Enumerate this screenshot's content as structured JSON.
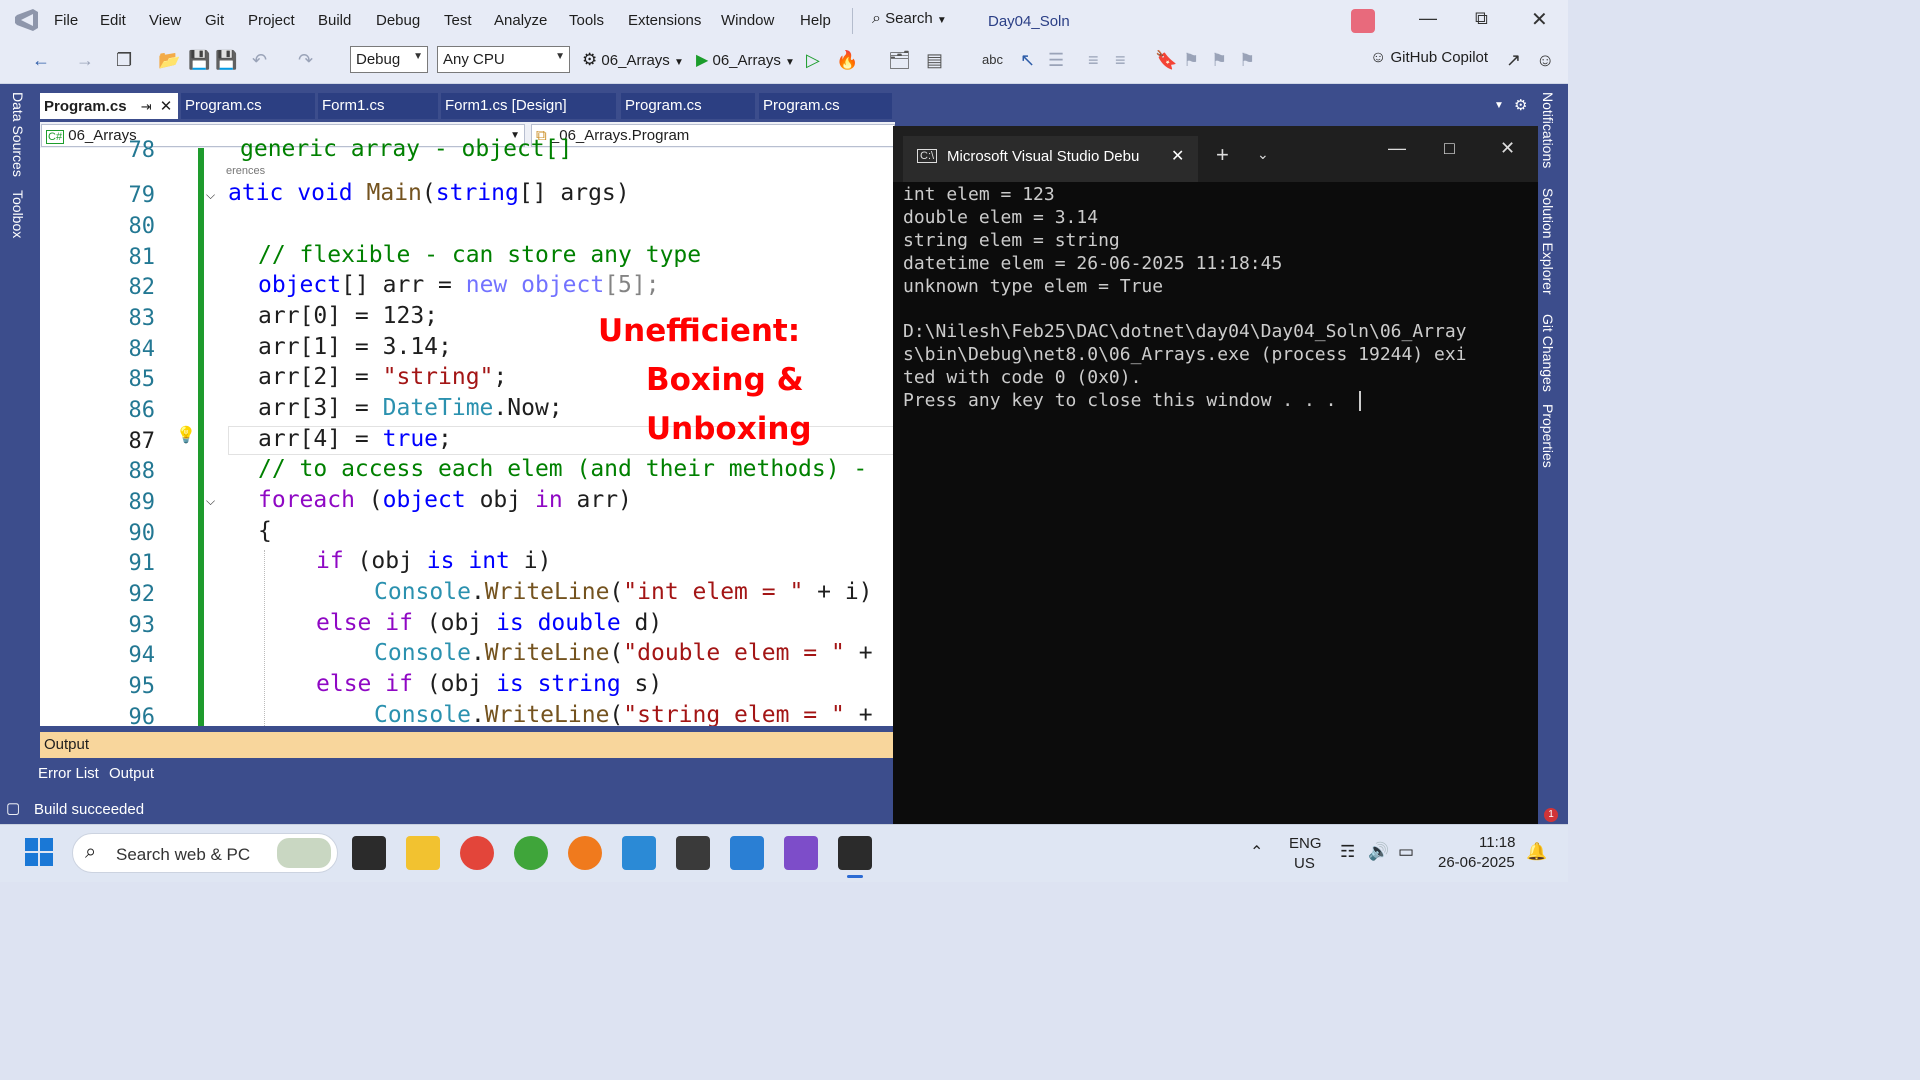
{
  "menu": {
    "items": [
      "File",
      "Edit",
      "View",
      "Git",
      "Project",
      "Build",
      "Debug",
      "Test",
      "Analyze",
      "Tools",
      "Extensions",
      "Window",
      "Help"
    ],
    "search_label": "Search",
    "solution_name": "Day04_Soln"
  },
  "toolbar": {
    "configuration": "Debug",
    "platform": "Any CPU",
    "startup_project": "06_Arrays",
    "run_target": "06_Arrays",
    "copilot_label": "GitHub Copilot"
  },
  "side_tabs_left": [
    "Data Sources",
    "Toolbox"
  ],
  "side_tabs_right": [
    "Notifications",
    "Solution Explorer",
    "Git Changes",
    "Properties"
  ],
  "doc_tabs": [
    {
      "label": "Program.cs",
      "active": true
    },
    {
      "label": "Program.cs",
      "active": false
    },
    {
      "label": "Form1.cs",
      "active": false
    },
    {
      "label": "Form1.cs [Design]",
      "active": false
    },
    {
      "label": "Program.cs",
      "active": false
    },
    {
      "label": "Program.cs",
      "active": false
    }
  ],
  "nav": {
    "project": "06_Arrays",
    "class": "_06_Arrays.Program"
  },
  "editor": {
    "codelens_text": "erences",
    "line_numbers": [
      "78",
      "79",
      "80",
      "81",
      "82",
      "83",
      "84",
      "85",
      "86",
      "87",
      "88",
      "89",
      "90",
      "91",
      "92",
      "93",
      "94",
      "95",
      "96"
    ],
    "lines": {
      "l78": "generic array - object[]",
      "l79_a": "atic ",
      "l79_b": "void ",
      "l79_c": "Main",
      "l79_d": "(",
      "l79_e": "string",
      "l79_f": "[] args)",
      "l81": "// flexible - can store any type",
      "l82_a": "object",
      "l82_b": "[] arr = ",
      "l82_c": "new ",
      "l82_d": "object",
      "l82_e": "[5];",
      "l83": "arr[0] = 123;",
      "l84": "arr[1] = 3.14;",
      "l85_a": "arr[2] = ",
      "l85_b": "\"string\"",
      "l85_c": ";",
      "l86_a": "arr[3] = ",
      "l86_b": "DateTime",
      "l86_c": ".Now;",
      "l87_a": "arr[4] = ",
      "l87_b": "true",
      "l87_c": ";",
      "l88": "// to access each elem (and their methods) -",
      "l89_a": "foreach ",
      "l89_b": "(",
      "l89_c": "object ",
      "l89_d": "obj ",
      "l89_e": "in ",
      "l89_f": "arr)",
      "l90": "{",
      "l91_a": "if ",
      "l91_b": "(obj ",
      "l91_c": "is ",
      "l91_d": "int ",
      "l91_e": "i)",
      "l92_a": "Console",
      "l92_b": ".",
      "l92_c": "WriteLine",
      "l92_d": "(",
      "l92_e": "\"int elem = \"",
      "l92_f": " + i)",
      "l93_a": "else if ",
      "l93_b": "(obj ",
      "l93_c": "is ",
      "l93_d": "double ",
      "l93_e": "d)",
      "l94_a": "Console",
      "l94_b": ".",
      "l94_c": "WriteLine",
      "l94_d": "(",
      "l94_e": "\"double elem = \"",
      "l94_f": " +",
      "l95_a": "else if ",
      "l95_b": "(obj ",
      "l95_c": "is ",
      "l95_d": "string ",
      "l95_e": "s)",
      "l96_a": "Console",
      "l96_b": ".",
      "l96_c": "WriteLine",
      "l96_d": "(",
      "l96_e": "\"string elem = \"",
      "l96_f": " +"
    },
    "annotation_lines": [
      "Unefficient:",
      "Boxing &",
      "Unboxing"
    ]
  },
  "output_panel": {
    "title": "Output",
    "tabs": [
      "Error List",
      "Output"
    ]
  },
  "status": {
    "message": "Build succeeded",
    "notification_count": "1"
  },
  "console": {
    "title": "Microsoft Visual Studio Debu",
    "lines": [
      "int elem = 123",
      "double elem = 3.14",
      "string elem = string",
      "datetime elem = 26-06-2025 11:18:45",
      "unknown type elem = True",
      "",
      "D:\\Nilesh\\Feb25\\DAC\\dotnet\\day04\\Day04_Soln\\06_Array",
      "s\\bin\\Debug\\net8.0\\06_Arrays.exe (process 19244) exi",
      "ted with code 0 (0x0).",
      "Press any key to close this window . . ."
    ]
  },
  "taskbar": {
    "search_placeholder": "Search web & PC",
    "language_line1": "ENG",
    "language_line2": "US",
    "time": "11:18",
    "date": "26-06-2025"
  },
  "colors": {
    "ide_chrome": "#3c4d8c",
    "editor_bg": "#ffffff",
    "console_bg": "#0c0c0c",
    "output_header": "#f8d69c",
    "change_bar": "#1e9b2d",
    "annotation": "#ff0000"
  }
}
